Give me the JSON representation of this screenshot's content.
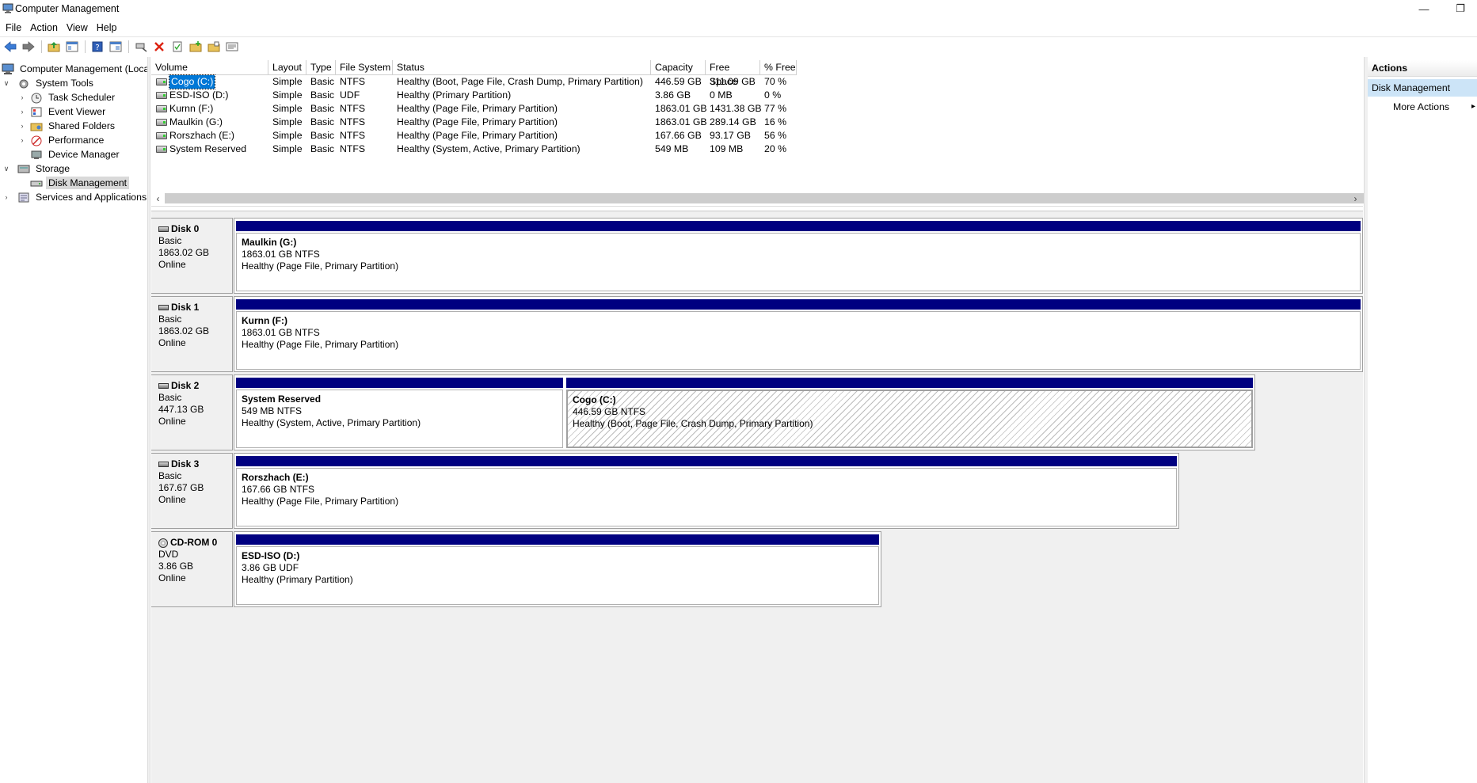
{
  "window": {
    "title": "Computer Management"
  },
  "menu": [
    "File",
    "Action",
    "View",
    "Help"
  ],
  "toolbar": {
    "icons": [
      "back-icon",
      "forward-icon",
      "up-folder-icon",
      "show-hide-tree-icon",
      "help-icon",
      "console-tree-icon",
      "connect-icon",
      "delete-icon",
      "properties-icon",
      "new-folder-icon",
      "open-folder-icon",
      "settings-list-icon"
    ]
  },
  "tree": {
    "root": "Computer Management (Local",
    "system_tools": "System Tools",
    "task_scheduler": "Task Scheduler",
    "event_viewer": "Event Viewer",
    "shared_folders": "Shared Folders",
    "performance": "Performance",
    "device_manager": "Device Manager",
    "storage": "Storage",
    "disk_management": "Disk Management",
    "services_apps": "Services and Applications"
  },
  "volume_table": {
    "headers": [
      "Volume",
      "Layout",
      "Type",
      "File System",
      "Status",
      "Capacity",
      "Free Space",
      "% Free"
    ],
    "rows": [
      [
        "Cogo (C:)",
        "Simple",
        "Basic",
        "NTFS",
        "Healthy (Boot, Page File, Crash Dump, Primary Partition)",
        "446.59 GB",
        "311.09 GB",
        "70 %"
      ],
      [
        "ESD-ISO (D:)",
        "Simple",
        "Basic",
        "UDF",
        "Healthy (Primary Partition)",
        "3.86 GB",
        "0 MB",
        "0 %"
      ],
      [
        "Kurnn (F:)",
        "Simple",
        "Basic",
        "NTFS",
        "Healthy (Page File, Primary Partition)",
        "1863.01 GB",
        "1431.38 GB",
        "77 %"
      ],
      [
        "Maulkin (G:)",
        "Simple",
        "Basic",
        "NTFS",
        "Healthy (Page File, Primary Partition)",
        "1863.01 GB",
        "289.14 GB",
        "16 %"
      ],
      [
        "Rorszhach (E:)",
        "Simple",
        "Basic",
        "NTFS",
        "Healthy (Page File, Primary Partition)",
        "167.66 GB",
        "93.17 GB",
        "56 %"
      ],
      [
        "System Reserved",
        "Simple",
        "Basic",
        "NTFS",
        "Healthy (System, Active, Primary Partition)",
        "549 MB",
        "109 MB",
        "20 %"
      ]
    ]
  },
  "disks": {
    "disk0": {
      "name": "Disk 0",
      "type": "Basic",
      "size": "1863.02 GB",
      "status": "Online",
      "p0": {
        "name": "Maulkin  (G:)",
        "size": "1863.01 GB NTFS",
        "status": "Healthy (Page File, Primary Partition)"
      }
    },
    "disk1": {
      "name": "Disk 1",
      "type": "Basic",
      "size": "1863.02 GB",
      "status": "Online",
      "p0": {
        "name": "Kurnn  (F:)",
        "size": "1863.01 GB NTFS",
        "status": "Healthy (Page File, Primary Partition)"
      }
    },
    "disk2": {
      "name": "Disk 2",
      "type": "Basic",
      "size": "447.13 GB",
      "status": "Online",
      "p0": {
        "name": "System Reserved",
        "size": "549 MB NTFS",
        "status": "Healthy (System, Active, Primary Partition)"
      },
      "p1": {
        "name": "Cogo  (C:)",
        "size": "446.59 GB NTFS",
        "status": "Healthy (Boot, Page File, Crash Dump, Primary Partition)"
      }
    },
    "disk3": {
      "name": "Disk 3",
      "type": "Basic",
      "size": "167.67 GB",
      "status": "Online",
      "p0": {
        "name": "Rorszhach  (E:)",
        "size": "167.66 GB NTFS",
        "status": "Healthy (Page File, Primary Partition)"
      }
    },
    "cdrom0": {
      "name": "CD-ROM 0",
      "type": "DVD",
      "size": "3.86 GB",
      "status": "Online",
      "p0": {
        "name": "ESD-ISO  (D:)",
        "size": "3.86 GB UDF",
        "status": "Healthy (Primary Partition)"
      }
    }
  },
  "actions": {
    "header": "Actions",
    "section": "Disk Management",
    "more": "More Actions"
  },
  "colors": {
    "partition_bar": "#000080",
    "selection": "#0078d7",
    "actions_section": "#cce4f7"
  }
}
